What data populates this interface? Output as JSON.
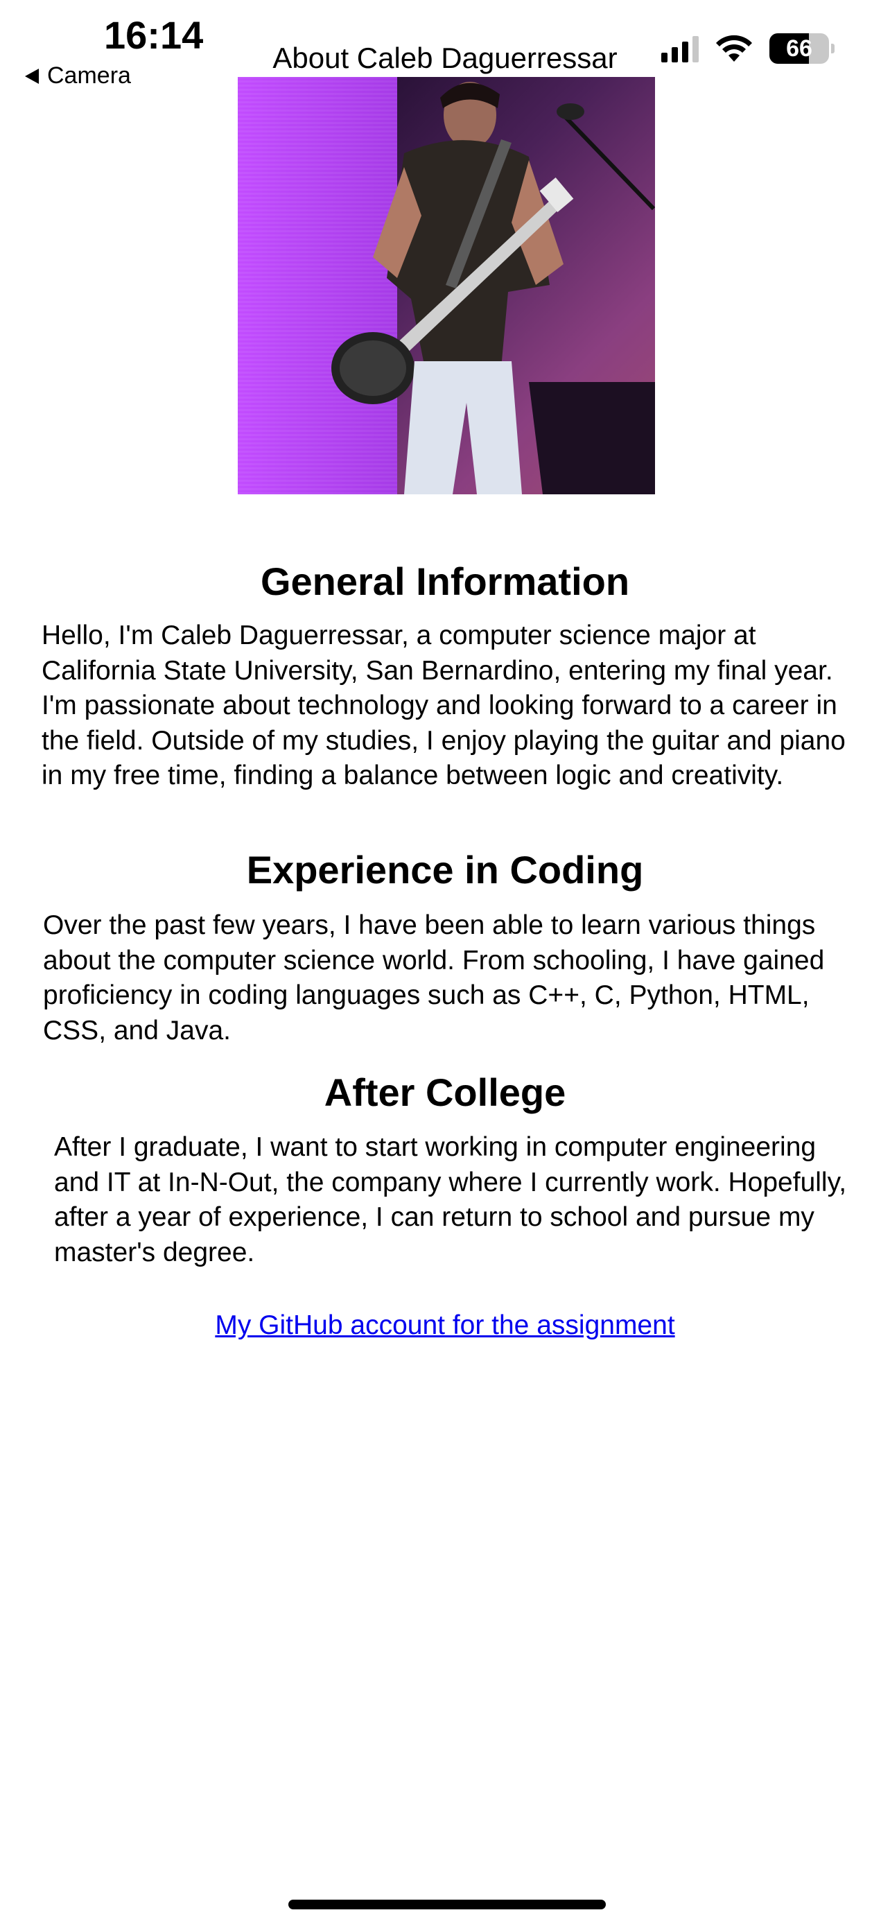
{
  "status_bar": {
    "time": "16:14",
    "battery": "66",
    "battery_level_percent": 66
  },
  "nav": {
    "back_label": "Camera",
    "title": "About Caleb Daguerressar"
  },
  "photo": {
    "icon": "guitar-performer-photo"
  },
  "sections": [
    {
      "heading": "General Information",
      "body": "Hello, I'm Caleb Daguerressar, a computer science major at California State University, San Bernardino, entering my final year. I'm passionate about technology and looking forward to a career in the field. Outside of my studies, I enjoy playing the guitar and piano in my free time, finding a balance between logic and creativity."
    },
    {
      "heading": "Experience in Coding",
      "body": "Over the past few years, I have been able to learn various things about the computer science world. From schooling, I have gained proficiency in coding languages such as C++, C, Python, HTML, CSS, and Java."
    },
    {
      "heading": "After College",
      "body": "After I graduate, I want to start working in computer engineering and IT at In-N-Out, the company where I currently work. Hopefully, after a year of experience, I can return to school and pursue my master's degree."
    }
  ],
  "link": {
    "text": "My GitHub account for the assignment"
  },
  "colors": {
    "link": "#0000ee",
    "text": "#000000",
    "background": "#ffffff"
  }
}
